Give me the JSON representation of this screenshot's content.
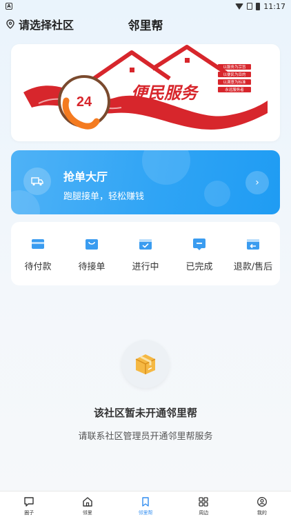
{
  "status_bar": {
    "time": "11:17",
    "app_badge": "A"
  },
  "header": {
    "location": "请选择社区",
    "title": "邻里帮"
  },
  "banner": {
    "text_24": "24",
    "headline": "便民服务",
    "side_lines": [
      "以服务为宗旨",
      "以便民为目的",
      "以满意为标准",
      "永远服务者"
    ]
  },
  "grab_orders": {
    "title": "抢单大厅",
    "subtitle": "跑腿接单，轻松赚钱"
  },
  "order_status": [
    {
      "label": "待付款",
      "icon": "wallet-icon"
    },
    {
      "label": "待接单",
      "icon": "bag-icon"
    },
    {
      "label": "进行中",
      "icon": "inprogress-icon"
    },
    {
      "label": "已完成",
      "icon": "done-icon"
    },
    {
      "label": "退款/售后",
      "icon": "refund-icon"
    }
  ],
  "empty_state": {
    "title": "该社区暂未开通邻里帮",
    "subtitle": "请联系社区管理员开通邻里帮服务",
    "icon": "package-icon"
  },
  "tabbar": [
    {
      "label": "圈子",
      "icon": "chat-icon",
      "active": false
    },
    {
      "label": "邻里",
      "icon": "home-icon",
      "active": false
    },
    {
      "label": "邻里帮",
      "icon": "bookmark-icon",
      "active": true
    },
    {
      "label": "周边",
      "icon": "grid-icon",
      "active": false
    },
    {
      "label": "我的",
      "icon": "user-icon",
      "active": false
    }
  ],
  "colors": {
    "accent": "#2fa4f5",
    "active_tab": "#2f8cf0",
    "banner_red": "#d7262c"
  }
}
